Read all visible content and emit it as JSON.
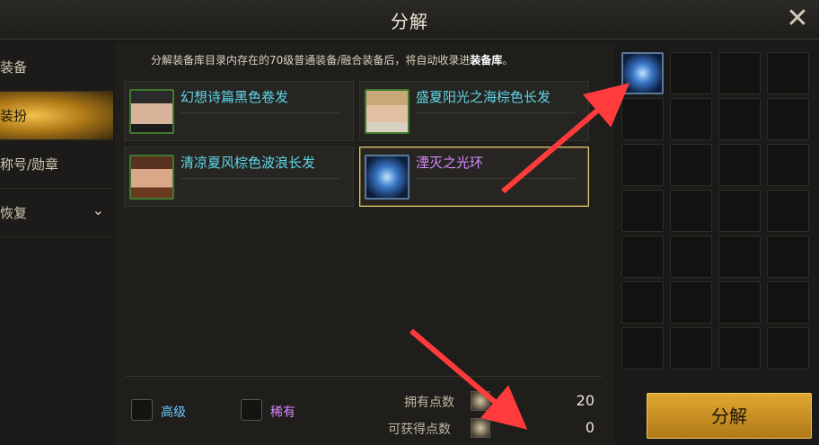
{
  "window": {
    "title": "分解",
    "close_icon": "close-icon"
  },
  "sidebar": {
    "items": [
      {
        "label": "装备",
        "active": false
      },
      {
        "label": "装扮",
        "active": true
      },
      {
        "label": "称号/勋章",
        "active": false
      },
      {
        "label": "恢复",
        "active": false,
        "icon": "chevron-down-icon"
      }
    ]
  },
  "notice": {
    "text": "分解装备库目录内存在的70级普通装备/融合装备后，将自动收录进",
    "bold": "装备库",
    "end": "。"
  },
  "items": [
    {
      "name": "幻想诗篇黑色卷发",
      "rarity_color": "#5fd6e8",
      "selected": false
    },
    {
      "name": "盛夏阳光之海棕色长发",
      "rarity_color": "#5fd6e8",
      "selected": false
    },
    {
      "name": "清凉夏风棕色波浪长发",
      "rarity_color": "#5fd6e8",
      "selected": false
    },
    {
      "name": "湮灭之光环",
      "rarity_color": "#d98aff",
      "selected": true
    }
  ],
  "filters": [
    {
      "label": "高级",
      "color": "#6ec8ff",
      "checked": false
    },
    {
      "label": "稀有",
      "color": "#d98aff",
      "checked": false
    }
  ],
  "points": {
    "owned_label": "拥有点数",
    "owned_value": "20",
    "gain_label": "可获得点数",
    "gain_value": "0"
  },
  "grid": {
    "filled_slots": 1,
    "total_visible_slots": 28
  },
  "action_button": {
    "label": "分解"
  },
  "colors": {
    "accent": "#e0a830",
    "annotation_arrow": "#ff3b3b"
  }
}
